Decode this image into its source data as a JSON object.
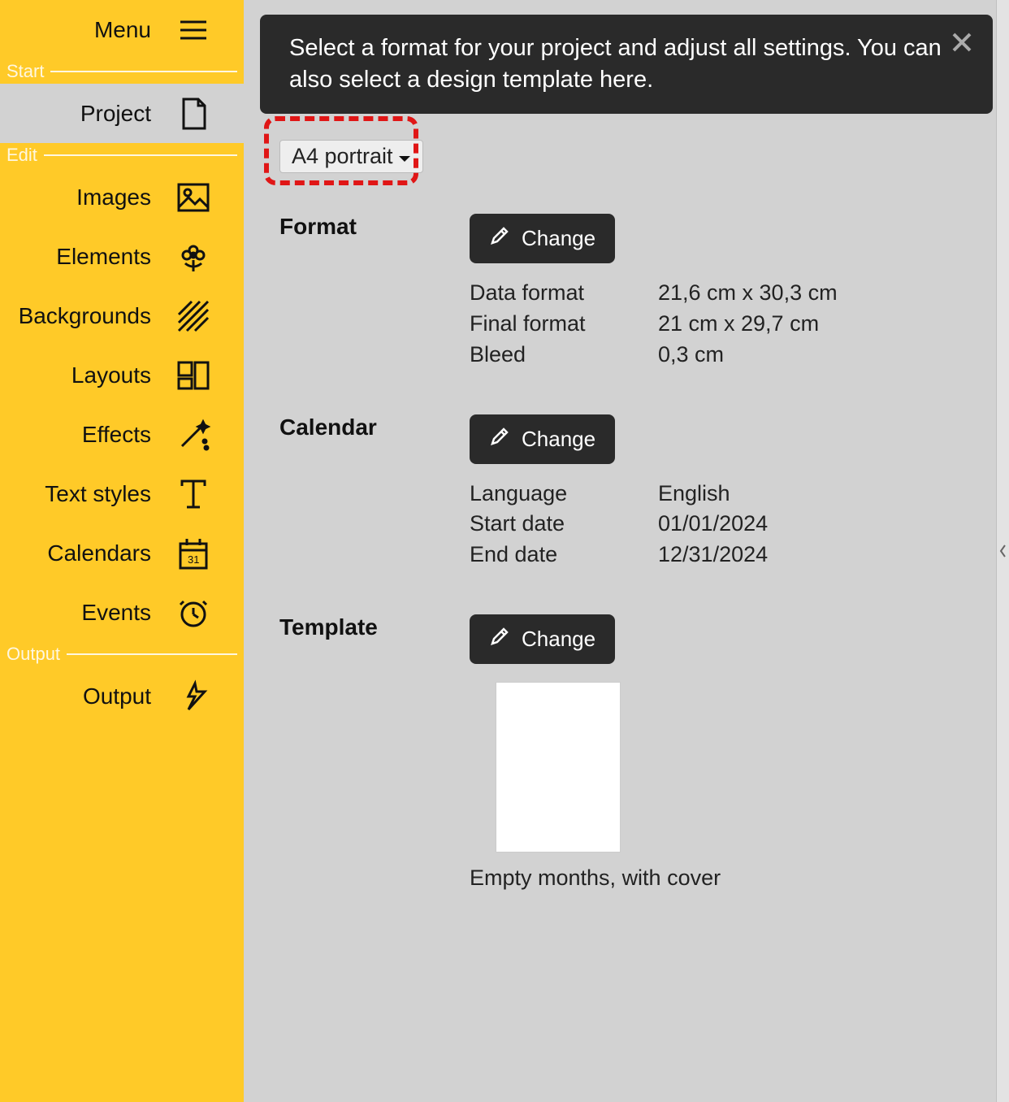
{
  "sidebar": {
    "menu_label": "Menu",
    "sections": {
      "start": "Start",
      "edit": "Edit",
      "output": "Output"
    },
    "items": {
      "project": "Project",
      "images": "Images",
      "elements": "Elements",
      "backgrounds": "Backgrounds",
      "layouts": "Layouts",
      "effects": "Effects",
      "text_styles": "Text styles",
      "calendars": "Calendars",
      "events": "Events",
      "output": "Output"
    }
  },
  "banner": {
    "text": "Select a format for your project and adjust all settings. You can also select a design template here."
  },
  "dropdown": {
    "selected": "A4 portrait"
  },
  "format": {
    "title": "Format",
    "change": "Change",
    "data_format_label": "Data format",
    "data_format_value": "21,6 cm x 30,3 cm",
    "final_format_label": "Final format",
    "final_format_value": "21 cm x 29,7 cm",
    "bleed_label": "Bleed",
    "bleed_value": "0,3 cm"
  },
  "calendar": {
    "title": "Calendar",
    "change": "Change",
    "language_label": "Language",
    "language_value": "English",
    "start_label": "Start date",
    "start_value": "01/01/2024",
    "end_label": "End date",
    "end_value": "12/31/2024"
  },
  "template": {
    "title": "Template",
    "change": "Change",
    "description": "Empty months, with cover"
  }
}
